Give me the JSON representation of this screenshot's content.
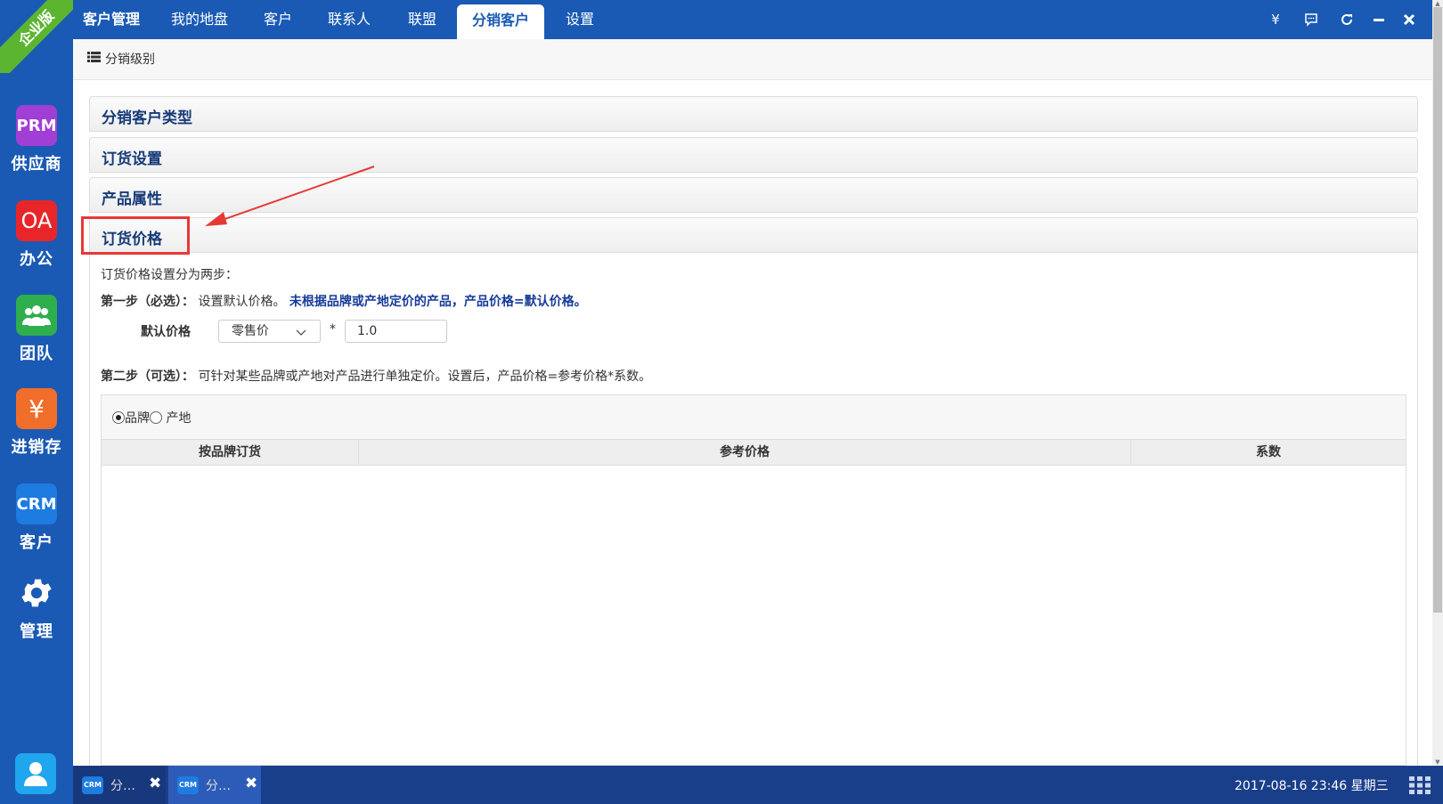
{
  "edition_badge": "企业版",
  "sidebar": {
    "items": [
      {
        "tile": "PRM",
        "label": "供应商",
        "color": "#a13ed6"
      },
      {
        "tile": "OA",
        "label": "办公",
        "color": "#e8262a"
      },
      {
        "tile": "team-icon",
        "label": "团队",
        "color": "#2fae4d"
      },
      {
        "tile": "¥",
        "label": "进销存",
        "color": "#f06d2a"
      },
      {
        "tile": "CRM",
        "label": "客户",
        "color": "#1e7be0"
      },
      {
        "tile": "gear-icon",
        "label": "管理",
        "color": "#1a5ab4"
      }
    ],
    "user_icon": "user-icon"
  },
  "topbar": {
    "tabs": [
      {
        "label": "客户管理"
      },
      {
        "label": "我的地盘"
      },
      {
        "label": "客户"
      },
      {
        "label": "联系人"
      },
      {
        "label": "联盟"
      },
      {
        "label": "分销客户",
        "active": true
      },
      {
        "label": "设置"
      }
    ],
    "icons": [
      "yen-icon",
      "message-icon",
      "refresh-icon",
      "minimize-icon",
      "close-icon"
    ],
    "yen_glyph": "¥"
  },
  "toolbar": {
    "level_button": "分销级别"
  },
  "panels": [
    {
      "title": "分销客户类型"
    },
    {
      "title": "订货设置"
    },
    {
      "title": "产品属性"
    },
    {
      "title": "订货价格",
      "expanded": true
    }
  ],
  "price_settings": {
    "intro": "订货价格设置分为两步：",
    "step1_label": "第一步（必选）：",
    "step1_text": "设置默认价格。",
    "step1_note": "未根据品牌或产地定价的产品，产品价格=默认价格。",
    "default_price_label": "默认价格",
    "default_price_select": "零售价",
    "multiply_sign": "*",
    "coefficient_value": "1.0",
    "step2_label": "第二步（可选）：",
    "step2_text": "可针对某些品牌或产地对产品进行单独定价。设置后，产品价格=参考价格*系数。"
  },
  "grid": {
    "radio_brand": "品牌",
    "radio_origin": "产地",
    "selected": "brand",
    "columns": [
      "按品牌订货",
      "参考价格",
      "系数"
    ],
    "rows": []
  },
  "taskbar": {
    "tasks": [
      {
        "badge": "CRM",
        "label": "分…"
      },
      {
        "badge": "CRM",
        "label": "分…"
      }
    ],
    "clock": "2017-08-16 23:46 星期三"
  }
}
